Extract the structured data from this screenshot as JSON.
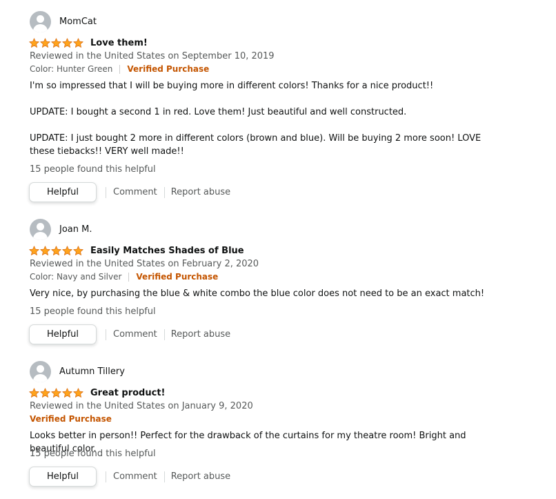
{
  "reviews": [
    {
      "name": "MomCat",
      "rating": 5,
      "title": "Love them!",
      "meta": "Reviewed in the United States on September 10, 2019",
      "color": "Color: Hunter Green",
      "verified": "Verified Purchase",
      "paragraphs": [
        "I'm so impressed that I will be buying more in different colors! Thanks for a nice product!!",
        "UPDATE: I bought a second 1 in red. Love them! Just beautiful and well constructed.",
        "UPDATE: I just bought 2 more in different colors (brown and blue). Will be buying 2 more soon! LOVE these tiebacks!! VERY well made!!"
      ],
      "helpful_count": "15 people found this helpful",
      "helpful_label": "Helpful",
      "comment_label": "Comment",
      "report_label": "Report abuse"
    },
    {
      "name": "Joan M.",
      "rating": 5,
      "title": "Easily Matches Shades of Blue",
      "meta": "Reviewed in the United States on February 2, 2020",
      "color": "Color: Navy and Silver",
      "verified": "Verified Purchase",
      "paragraphs": [
        "Very nice, by purchasing the blue & white combo the blue color does not need to be an exact match!"
      ],
      "helpful_count": "15 people found this helpful",
      "helpful_label": "Helpful",
      "comment_label": "Comment",
      "report_label": "Report abuse"
    },
    {
      "name": "Autumn Tillery",
      "rating": 5,
      "title": "Great product!",
      "meta": "Reviewed in the United States on January 9, 2020",
      "color": "",
      "verified": "Verified Purchase",
      "paragraphs": [
        "Looks better in person!! Perfect for the drawback of the curtains for my theatre room! Bright and beautiful color."
      ],
      "helpful_count": "15 people found this helpful",
      "helpful_label": "Helpful",
      "comment_label": "Comment",
      "report_label": "Report abuse"
    }
  ],
  "colors": {
    "star": "#ffa41c",
    "verified": "#c45500",
    "secondary_text": "#565959"
  }
}
